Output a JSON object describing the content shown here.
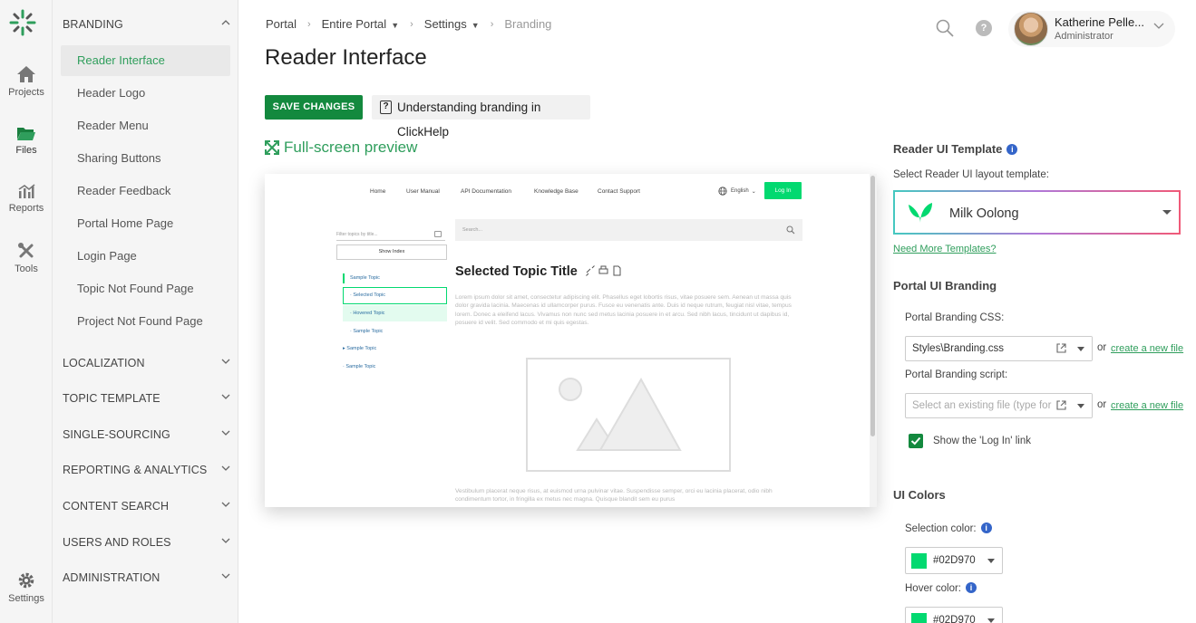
{
  "rail": {
    "items": [
      {
        "label": "Projects",
        "icon": "home-icon"
      },
      {
        "label": "Files",
        "icon": "folder-icon"
      },
      {
        "label": "Reports",
        "icon": "chart-icon"
      },
      {
        "label": "Tools",
        "icon": "tools-icon"
      },
      {
        "label": "Settings",
        "icon": "gear-icon"
      }
    ]
  },
  "nav": {
    "branding_title": "BRANDING",
    "branding_items": [
      "Reader Interface",
      "Header Logo",
      "Reader Menu",
      "Sharing Buttons",
      "Reader Feedback",
      "Portal Home Page",
      "Login Page",
      "Topic Not Found Page",
      "Project Not Found Page"
    ],
    "groups": [
      "LOCALIZATION",
      "TOPIC TEMPLATE",
      "SINGLE-SOURCING",
      "REPORTING & ANALYTICS",
      "CONTENT SEARCH",
      "USERS AND ROLES",
      "ADMINISTRATION"
    ]
  },
  "header": {
    "breadcrumb": [
      "Portal",
      "Entire Portal",
      "Settings",
      "Branding"
    ],
    "title": "Reader Interface",
    "user_name": "Katherine Pelle...",
    "user_role": "Administrator"
  },
  "actions": {
    "save": "SAVE CHANGES",
    "help": "Understanding branding in ClickHelp",
    "fullscreen": "Full-screen preview"
  },
  "preview": {
    "nav": [
      "Home",
      "User Manual",
      "API Documentation",
      "Knowledge Base",
      "Contact Support"
    ],
    "language": "English",
    "login": "Log In",
    "filter_placeholder": "Filter topics by title...",
    "show_index": "Show Index",
    "tree": [
      "Sample Topic",
      "Selected Topic",
      "Hovered Topic",
      "Sample Topic",
      "Sample Topic",
      "Sample Topic"
    ],
    "search_placeholder": "Search...",
    "topic_title": "Selected Topic Title",
    "para1": "Lorem ipsum dolor sit amet, consectetur adipiscing elit. Phasellus eget lobortis risus, vitae posuere sem. Aenean ut massa quis dolor gravida lacinia. Maecenas id ullamcorper purus. Fusce eu venenatis ante. Duis id neque rutrum, feugiat nisl vitae, tempus lorem. Donec a eleifend lacus. Vivamus non nunc sed metus lacinia posuere in et arcu. Sed nibh lacus, tincidunt ut dapibus id, posuere id velit. Sed commodo et mi quis egestas.",
    "para2": "Vestibulum placerat neque risus, at euismod urna pulvinar vitae. Suspendisse semper, orci eu lacinia placerat, odio nibh condimentum tortor, in fringilla ex metus nec magna. Quisque blandit sem eu purus"
  },
  "right": {
    "template_heading": "Reader UI Template",
    "template_label": "Select Reader UI layout template:",
    "template_value": "Milk Oolong",
    "more_templates": "Need More Templates?",
    "portal_heading": "Portal UI Branding",
    "css_label": "Portal Branding CSS:",
    "css_value": "Styles\\Branding.css",
    "script_label": "Portal Branding script:",
    "script_placeholder": "Select an existing file (type for quick search)",
    "or": "or",
    "create_new": "create a new file",
    "show_login": "Show the 'Log In' link",
    "colors_heading": "UI Colors",
    "selection_label": "Selection color:",
    "selection_value": "#02D970",
    "hover_label": "Hover color:",
    "hover_value": "#02D970"
  },
  "colors": {
    "accent": "#2f9e5c",
    "primary_button": "#13893e",
    "selection": "#02D970"
  }
}
